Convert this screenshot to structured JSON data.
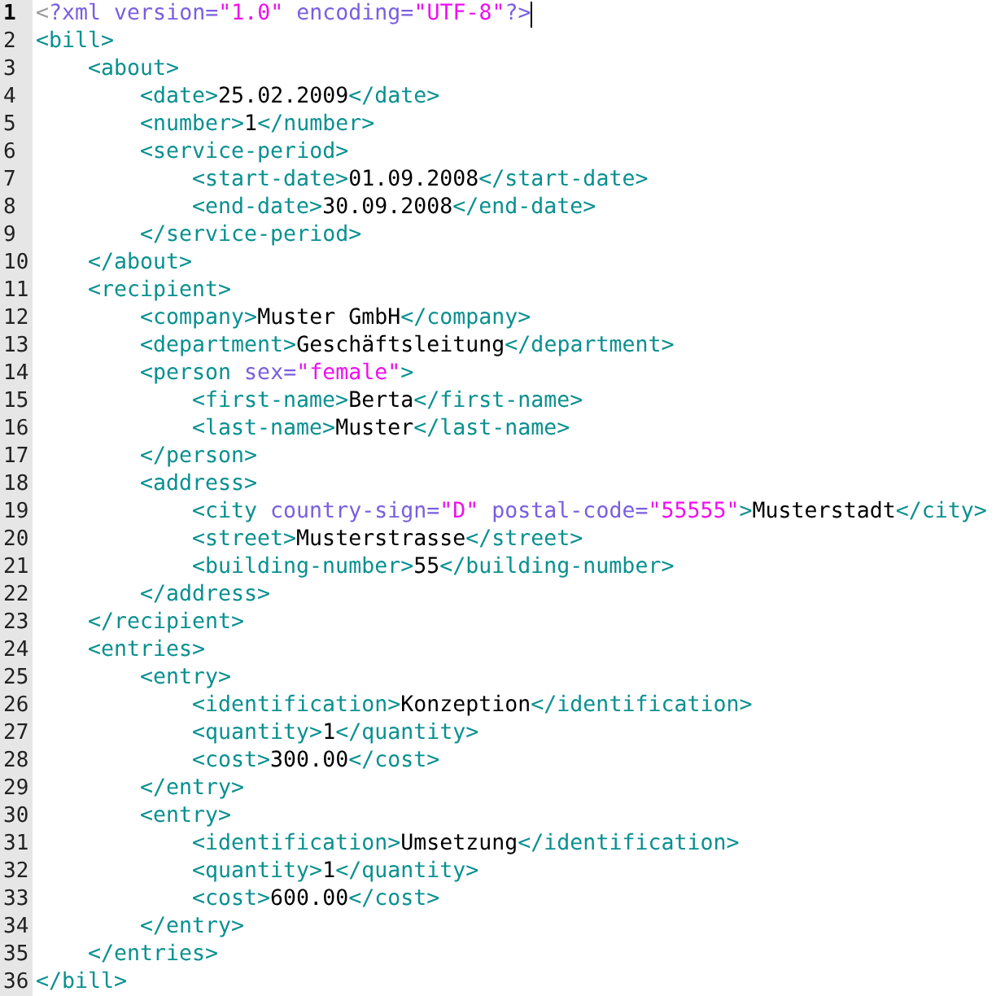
{
  "lines": [
    {
      "number": "1",
      "current": true,
      "tokens": [
        {
          "kind": "pi-open",
          "text": "<"
        },
        {
          "kind": "pi",
          "text": "?xml version="
        },
        {
          "kind": "string",
          "text": "\"1.0\""
        },
        {
          "kind": "pi",
          "text": " encoding="
        },
        {
          "kind": "string",
          "text": "\"UTF-8\""
        },
        {
          "kind": "pi",
          "text": "?>"
        }
      ]
    },
    {
      "number": "2",
      "current": false,
      "tokens": [
        {
          "kind": "tag",
          "text": "<bill>"
        }
      ],
      "children": [
        {
          "number": "3",
          "current": false,
          "tokens": [
            {
              "kind": "tag",
              "text": "<about>"
            }
          ],
          "children": [
            {
              "number": "4",
              "current": false,
              "tokens": [
                {
                  "kind": "tag",
                  "text": "<date>"
                },
                {
                  "kind": "text",
                  "text": "25.02.2009"
                },
                {
                  "kind": "tag",
                  "text": "</date>"
                }
              ]
            },
            {
              "number": "5",
              "current": false,
              "tokens": [
                {
                  "kind": "tag",
                  "text": "<number>"
                },
                {
                  "kind": "text",
                  "text": "1"
                },
                {
                  "kind": "tag",
                  "text": "</number>"
                }
              ]
            },
            {
              "number": "6",
              "current": false,
              "tokens": [
                {
                  "kind": "tag",
                  "text": "<service-period>"
                }
              ],
              "children": [
                {
                  "number": "7",
                  "current": false,
                  "tokens": [
                    {
                      "kind": "tag",
                      "text": "<start-date>"
                    },
                    {
                      "kind": "text",
                      "text": "01.09.2008"
                    },
                    {
                      "kind": "tag",
                      "text": "</start-date>"
                    }
                  ]
                },
                {
                  "number": "8",
                  "current": false,
                  "tokens": [
                    {
                      "kind": "tag",
                      "text": "<end-date>"
                    },
                    {
                      "kind": "text",
                      "text": "30.09.2008"
                    },
                    {
                      "kind": "tag",
                      "text": "</end-date>"
                    }
                  ]
                }
              ]
            },
            {
              "number": "9",
              "current": false,
              "tokens": [
                {
                  "kind": "tag",
                  "text": "</service-period>"
                }
              ]
            }
          ]
        },
        {
          "number": "10",
          "current": false,
          "tokens": [
            {
              "kind": "tag",
              "text": "</about>"
            }
          ]
        },
        {
          "number": "11",
          "current": false,
          "tokens": [
            {
              "kind": "tag",
              "text": "<recipient>"
            }
          ],
          "children": [
            {
              "number": "12",
              "current": false,
              "tokens": [
                {
                  "kind": "tag",
                  "text": "<company>"
                },
                {
                  "kind": "text",
                  "text": "Muster GmbH"
                },
                {
                  "kind": "tag",
                  "text": "</company>"
                }
              ]
            },
            {
              "number": "13",
              "current": false,
              "tokens": [
                {
                  "kind": "tag",
                  "text": "<department>"
                },
                {
                  "kind": "text",
                  "text": "Geschäftsleitung"
                },
                {
                  "kind": "tag",
                  "text": "</department>"
                }
              ]
            },
            {
              "number": "14",
              "current": false,
              "tokens": [
                {
                  "kind": "tag",
                  "text": "<person"
                },
                {
                  "kind": "attr",
                  "text": " sex="
                },
                {
                  "kind": "string",
                  "text": "\"female\""
                },
                {
                  "kind": "tag",
                  "text": ">"
                }
              ],
              "children": [
                {
                  "number": "15",
                  "current": false,
                  "tokens": [
                    {
                      "kind": "tag",
                      "text": "<first-name>"
                    },
                    {
                      "kind": "text",
                      "text": "Berta"
                    },
                    {
                      "kind": "tag",
                      "text": "</first-name>"
                    }
                  ]
                },
                {
                  "number": "16",
                  "current": false,
                  "tokens": [
                    {
                      "kind": "tag",
                      "text": "<last-name>"
                    },
                    {
                      "kind": "text",
                      "text": "Muster"
                    },
                    {
                      "kind": "tag",
                      "text": "</last-name>"
                    }
                  ]
                }
              ]
            },
            {
              "number": "17",
              "current": false,
              "tokens": [
                {
                  "kind": "tag",
                  "text": "</person>"
                }
              ]
            },
            {
              "number": "18",
              "current": false,
              "tokens": [
                {
                  "kind": "tag",
                  "text": "<address>"
                }
              ],
              "children": [
                {
                  "number": "19",
                  "current": false,
                  "tokens": [
                    {
                      "kind": "tag",
                      "text": "<city"
                    },
                    {
                      "kind": "attr",
                      "text": " country-sign="
                    },
                    {
                      "kind": "string",
                      "text": "\"D\""
                    },
                    {
                      "kind": "attr",
                      "text": " postal-code="
                    },
                    {
                      "kind": "string",
                      "text": "\"55555\""
                    },
                    {
                      "kind": "tag",
                      "text": ">"
                    },
                    {
                      "kind": "text",
                      "text": "Musterstadt"
                    },
                    {
                      "kind": "tag",
                      "text": "</city>"
                    }
                  ]
                },
                {
                  "number": "20",
                  "current": false,
                  "tokens": [
                    {
                      "kind": "tag",
                      "text": "<street>"
                    },
                    {
                      "kind": "text",
                      "text": "Musterstrasse"
                    },
                    {
                      "kind": "tag",
                      "text": "</street>"
                    }
                  ]
                },
                {
                  "number": "21",
                  "current": false,
                  "tokens": [
                    {
                      "kind": "tag",
                      "text": "<building-number>"
                    },
                    {
                      "kind": "text",
                      "text": "55"
                    },
                    {
                      "kind": "tag",
                      "text": "</building-number>"
                    }
                  ]
                }
              ]
            },
            {
              "number": "22",
              "current": false,
              "tokens": [
                {
                  "kind": "tag",
                  "text": "</address>"
                }
              ]
            }
          ]
        },
        {
          "number": "23",
          "current": false,
          "tokens": [
            {
              "kind": "tag",
              "text": "</recipient>"
            }
          ]
        },
        {
          "number": "24",
          "current": false,
          "tokens": [
            {
              "kind": "tag",
              "text": "<entries>"
            }
          ],
          "children": [
            {
              "number": "25",
              "current": false,
              "tokens": [
                {
                  "kind": "tag",
                  "text": "<entry>"
                }
              ],
              "children": [
                {
                  "number": "26",
                  "current": false,
                  "tokens": [
                    {
                      "kind": "tag",
                      "text": "<identification>"
                    },
                    {
                      "kind": "text",
                      "text": "Konzeption"
                    },
                    {
                      "kind": "tag",
                      "text": "</identification>"
                    }
                  ]
                },
                {
                  "number": "27",
                  "current": false,
                  "tokens": [
                    {
                      "kind": "tag",
                      "text": "<quantity>"
                    },
                    {
                      "kind": "text",
                      "text": "1"
                    },
                    {
                      "kind": "tag",
                      "text": "</quantity>"
                    }
                  ]
                },
                {
                  "number": "28",
                  "current": false,
                  "tokens": [
                    {
                      "kind": "tag",
                      "text": "<cost>"
                    },
                    {
                      "kind": "text",
                      "text": "300.00"
                    },
                    {
                      "kind": "tag",
                      "text": "</cost>"
                    }
                  ]
                }
              ]
            },
            {
              "number": "29",
              "current": false,
              "tokens": [
                {
                  "kind": "tag",
                  "text": "</entry>"
                }
              ]
            },
            {
              "number": "30",
              "current": false,
              "tokens": [
                {
                  "kind": "tag",
                  "text": "<entry>"
                }
              ],
              "children": [
                {
                  "number": "31",
                  "current": false,
                  "tokens": [
                    {
                      "kind": "tag",
                      "text": "<identification>"
                    },
                    {
                      "kind": "text",
                      "text": "Umsetzung"
                    },
                    {
                      "kind": "tag",
                      "text": "</identification>"
                    }
                  ]
                },
                {
                  "number": "32",
                  "current": false,
                  "tokens": [
                    {
                      "kind": "tag",
                      "text": "<quantity>"
                    },
                    {
                      "kind": "text",
                      "text": "1"
                    },
                    {
                      "kind": "tag",
                      "text": "</quantity>"
                    }
                  ]
                },
                {
                  "number": "33",
                  "current": false,
                  "tokens": [
                    {
                      "kind": "tag",
                      "text": "<cost>"
                    },
                    {
                      "kind": "text",
                      "text": "600.00"
                    },
                    {
                      "kind": "tag",
                      "text": "</cost>"
                    }
                  ]
                }
              ]
            },
            {
              "number": "34",
              "current": false,
              "tokens": [
                {
                  "kind": "tag",
                  "text": "</entry>"
                }
              ]
            }
          ]
        },
        {
          "number": "35",
          "current": false,
          "tokens": [
            {
              "kind": "tag",
              "text": "</entries>"
            }
          ]
        }
      ]
    },
    {
      "number": "36",
      "current": false,
      "tokens": [
        {
          "kind": "tag",
          "text": "</bill>"
        }
      ]
    }
  ]
}
